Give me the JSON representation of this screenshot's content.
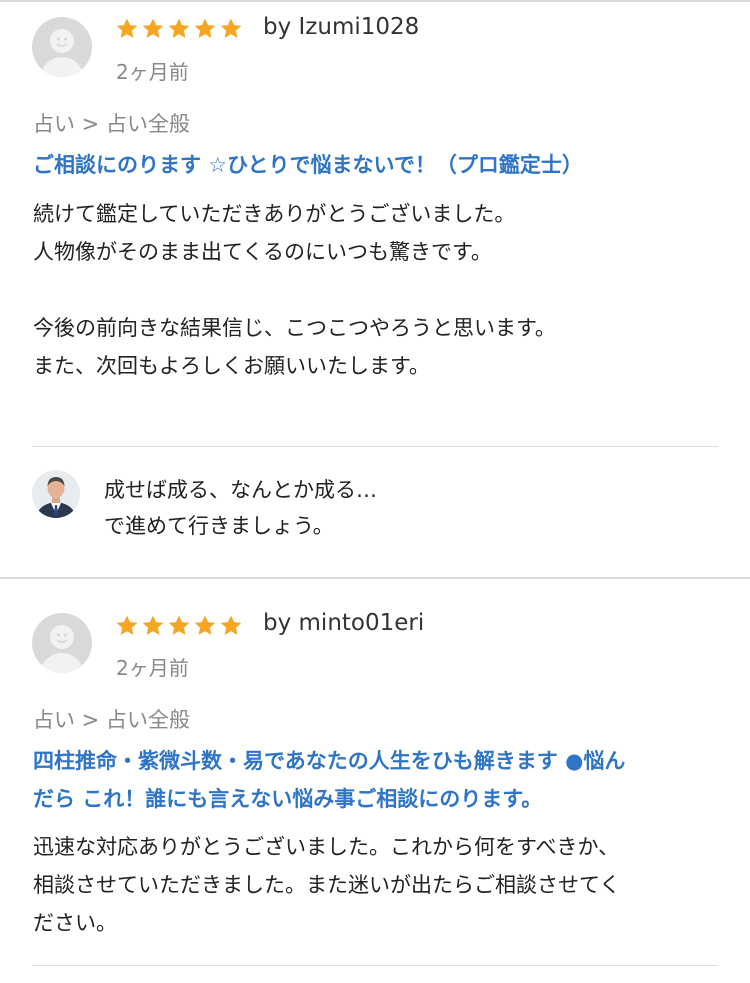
{
  "reviews": [
    {
      "rating": 5,
      "byline": "by Izumi1028",
      "date": "2ヶ月前",
      "category": "占い > 占い全般",
      "service_title": "ご相談にのります ☆ひとりで悩まないで！（プロ鑑定士）",
      "body_lines": [
        "続けて鑑定していただきありがとうございました。",
        "人物像がそのまま出てくるのにいつも驚きです。",
        "",
        "今後の前向きな結果信じ、こつこつやろうと思います。",
        "また、次回もよろしくお願いいたします。"
      ],
      "reply_lines": [
        "成せば成る、なんとか成る…",
        "で進めて行きましょう。"
      ]
    },
    {
      "rating": 5,
      "byline": "by minto01eri",
      "date": "2ヶ月前",
      "category": "占い > 占い全般",
      "service_title_lines": [
        "四柱推命・紫微斗数・易であなたの人生をひも解きます ●悩ん",
        "だら これ！誰にも言えない悩み事ご相談にのります。"
      ],
      "body_lines": [
        "迅速な対応ありがとうございました。これから何をすべきか、",
        "相談させていただきました。また迷いが出たらご相談させてく",
        "ださい。"
      ]
    }
  ],
  "colors": {
    "star": "#f5a623",
    "link": "#2f75c7",
    "muted": "#888888"
  }
}
